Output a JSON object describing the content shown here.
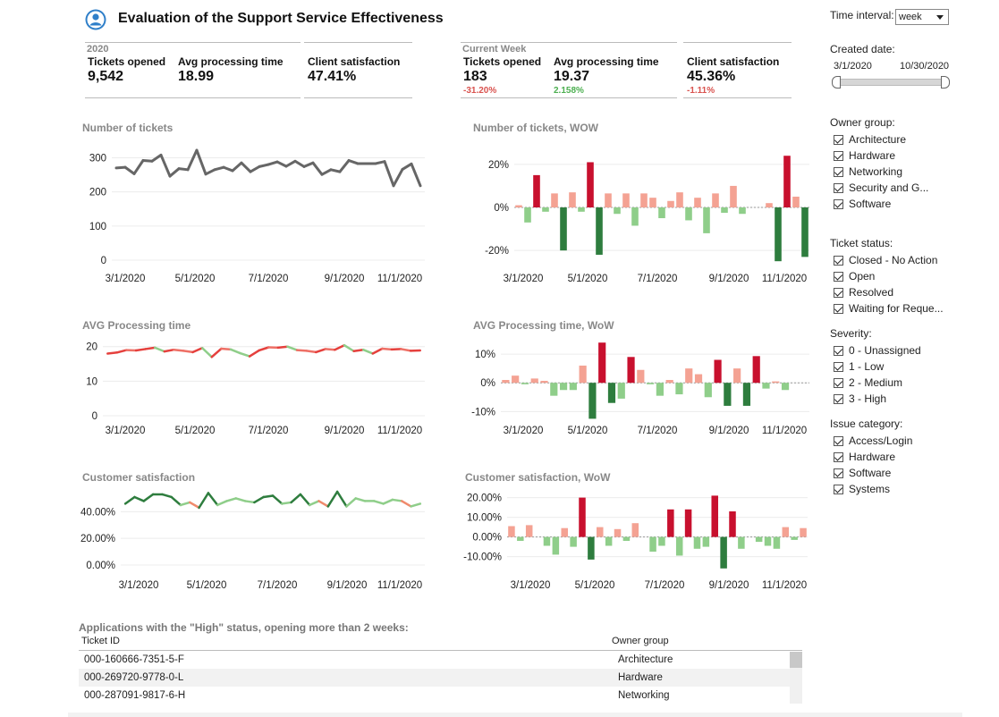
{
  "header": {
    "title": "Evaluation of the Support Service Effectiveness"
  },
  "kpi_year": {
    "period_label": "2020",
    "tickets_label": "Tickets opened",
    "tickets_value": "9,542",
    "avg_label": "Avg processing time",
    "avg_value": "18.99",
    "sat_label": "Client satisfaction",
    "sat_value": "47.41%"
  },
  "kpi_week": {
    "period_label": "Current Week",
    "tickets_label": "Tickets opened",
    "tickets_value": "183",
    "tickets_change": "-31.20%",
    "avg_label": "Avg processing time",
    "avg_value": "19.37",
    "avg_change": "2.158%",
    "sat_label": "Client satisfaction",
    "sat_value": "45.36%",
    "sat_change": "-1.11%"
  },
  "colors": {
    "pos_dark": "#c8102e",
    "pos_light": "#f4a293",
    "neg_dark": "#2e7d3e",
    "neg_light": "#8fce8a",
    "line_gray": "#666666"
  },
  "filters": {
    "time_interval_label": "Time interval:",
    "time_interval_value": "week",
    "created_date_label": "Created date:",
    "date_start": "3/1/2020",
    "date_end": "10/30/2020",
    "owner_group_label": "Owner group:",
    "owner_group": [
      "Architecture",
      "Hardware",
      "Networking",
      "Security and G...",
      "Software"
    ],
    "ticket_status_label": "Ticket status:",
    "ticket_status": [
      "Closed - No Action",
      "Open",
      "Resolved",
      "Waiting for Reque..."
    ],
    "severity_label": "Severity:",
    "severity": [
      "0 - Unassigned",
      "1 - Low",
      "2 - Medium",
      "3 - High"
    ],
    "issue_category_label": "Issue category:",
    "issue_category": [
      "Access/Login",
      "Hardware",
      "Software",
      "Systems"
    ]
  },
  "table": {
    "caption": "Applications with the \"High\" status, opening more than 2 weeks:",
    "col_id": "Ticket ID",
    "col_owner": "Owner group",
    "rows": [
      {
        "id": "000-160666-7351-5-F",
        "owner": "Architecture"
      },
      {
        "id": "000-269720-9778-0-L",
        "owner": "Hardware"
      },
      {
        "id": "000-287091-9817-6-H",
        "owner": "Networking"
      }
    ]
  },
  "chart_data": [
    {
      "id": "tickets",
      "type": "line",
      "title": "Number of tickets",
      "x_ticks": [
        "3/1/2020",
        "5/1/2020",
        "7/1/2020",
        "9/1/2020",
        "11/1/2020"
      ],
      "y_ticks": [
        "0",
        "100",
        "200",
        "300"
      ],
      "ylim": [
        0,
        330
      ],
      "values": [
        270,
        272,
        253,
        292,
        290,
        308,
        246,
        268,
        265,
        322,
        252,
        265,
        272,
        262,
        285,
        259,
        274,
        280,
        288,
        275,
        290,
        274,
        285,
        251,
        265,
        259,
        292,
        283,
        283,
        283,
        289,
        218,
        266,
        282,
        218
      ]
    },
    {
      "id": "tickets_wow",
      "type": "bar",
      "title": "Number of tickets, WOW",
      "x_ticks": [
        "3/1/2020",
        "5/1/2020",
        "7/1/2020",
        "9/1/2020",
        "11/1/2020"
      ],
      "y_ticks": [
        "20%",
        "0%",
        "-20%"
      ],
      "ylim": [
        -0.27,
        0.27
      ],
      "values": [
        0.01,
        -0.07,
        0.15,
        -0.02,
        0.065,
        -0.2,
        0.07,
        -0.02,
        0.21,
        -0.22,
        0.065,
        -0.03,
        0.065,
        -0.085,
        0.065,
        0.045,
        -0.05,
        0.03,
        0.07,
        -0.06,
        0.045,
        -0.12,
        0.065,
        -0.025,
        0.1,
        -0.03,
        0,
        0,
        0.02,
        -0.25,
        0.24,
        0.05,
        -0.23
      ]
    },
    {
      "id": "processing",
      "type": "line",
      "title": "AVG Processing time",
      "x_ticks": [
        "3/1/2020",
        "5/1/2020",
        "7/1/2020",
        "9/1/2020",
        "11/1/2020"
      ],
      "y_ticks": [
        "0",
        "10",
        "20"
      ],
      "ylim": [
        0,
        22
      ],
      "values": [
        18.0,
        18.3,
        19.0,
        18.9,
        19.3,
        19.7,
        18.6,
        19.1,
        18.8,
        18.4,
        19.6,
        17.0,
        19.4,
        19.2,
        18.1,
        17.2,
        18.9,
        19.8,
        19.7,
        20.0,
        19.0,
        18.8,
        18.4,
        19.3,
        19.1,
        20.4,
        18.7,
        19.1,
        18.0,
        19.4,
        19.2,
        19.3,
        18.8,
        18.9
      ]
    },
    {
      "id": "processing_wow",
      "type": "bar",
      "title": "AVG Processing time, WoW",
      "x_ticks": [
        "3/1/2020",
        "5/1/2020",
        "7/1/2020",
        "9/1/2020",
        "11/1/2020"
      ],
      "y_ticks": [
        "10%",
        "0%",
        "-10%"
      ],
      "ylim": [
        -0.13,
        0.15
      ],
      "values": [
        0.01,
        0.025,
        -0.005,
        0.015,
        0.007,
        -0.045,
        -0.025,
        -0.025,
        0.06,
        -0.125,
        0.14,
        -0.07,
        -0.055,
        0.09,
        0.045,
        -0.005,
        -0.045,
        0.01,
        -0.04,
        0.05,
        0.03,
        -0.05,
        0.08,
        -0.08,
        0.05,
        -0.08,
        0.093,
        -0.02,
        0.005,
        -0.025,
        0,
        0
      ]
    },
    {
      "id": "satisfaction",
      "type": "line",
      "title": "Customer satisfaction",
      "x_ticks": [
        "3/1/2020",
        "5/1/2020",
        "7/1/2020",
        "9/1/2020",
        "11/1/2020"
      ],
      "y_ticks": [
        "0.00%",
        "20.00%",
        "40.00%"
      ],
      "ylim": [
        0,
        0.55
      ],
      "values": [
        0.46,
        0.51,
        0.48,
        0.53,
        0.53,
        0.51,
        0.45,
        0.47,
        0.43,
        0.54,
        0.45,
        0.48,
        0.5,
        0.48,
        0.47,
        0.51,
        0.52,
        0.46,
        0.47,
        0.53,
        0.45,
        0.48,
        0.44,
        0.55,
        0.44,
        0.5,
        0.48,
        0.48,
        0.46,
        0.49,
        0.48,
        0.44,
        0.46
      ]
    },
    {
      "id": "satisfaction_wow",
      "type": "bar",
      "title": "Customer satisfaction, WoW",
      "x_ticks": [
        "3/1/2020",
        "5/1/2020",
        "7/1/2020",
        "9/1/2020",
        "11/1/2020"
      ],
      "y_ticks": [
        "20.00%",
        "10.00%",
        "0.00%",
        "-10.00%"
      ],
      "ylim": [
        -0.17,
        0.23
      ],
      "values": [
        0.055,
        -0.02,
        0.06,
        0,
        -0.045,
        -0.09,
        0.045,
        -0.05,
        0.2,
        -0.115,
        0.05,
        -0.045,
        0.04,
        -0.02,
        0.07,
        0,
        -0.075,
        -0.045,
        0.14,
        -0.095,
        0.14,
        -0.06,
        -0.05,
        0.21,
        -0.16,
        0.13,
        -0.06,
        0,
        -0.025,
        -0.045,
        -0.06,
        0.05,
        -0.015,
        0.045
      ]
    }
  ]
}
